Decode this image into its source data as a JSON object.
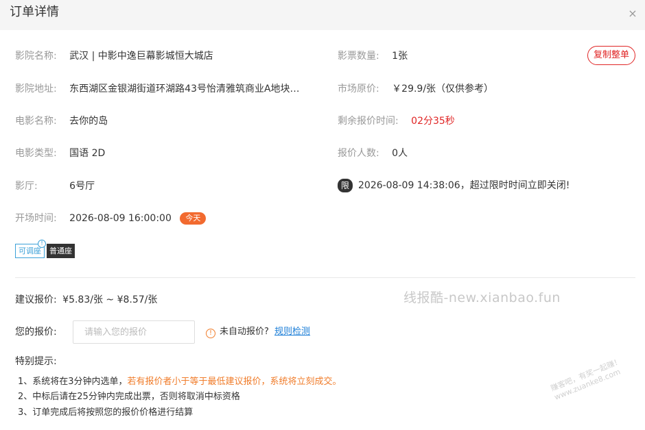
{
  "header": {
    "title": "订单详情",
    "close_glyph": "×"
  },
  "left_fields": [
    {
      "label": "影院名称:",
      "value": "武汉 | 中影中逸巨幕影城恒大城店"
    },
    {
      "label": "影院地址:",
      "value": "东西湖区金银湖街道环湖路43号怡清雅筑商业A地块…"
    },
    {
      "label": "电影名称:",
      "value": "去你的岛"
    },
    {
      "label": "电影类型:",
      "value": "国语 2D"
    },
    {
      "label": "影厅:",
      "value": "6号厅"
    },
    {
      "label": "开场时间:",
      "value": "2026-08-09 16:00:00",
      "badge": "今天"
    }
  ],
  "right_fields": [
    {
      "label": "影票数量:",
      "value": "1张"
    },
    {
      "label": "市场原价:",
      "value": "￥29.9/张（仅供参考）"
    },
    {
      "label": "剩余报价时间:",
      "value": "02分35秒"
    },
    {
      "label": "报价人数:",
      "value": "0人"
    }
  ],
  "deadline": {
    "badge": "限",
    "text": "2026-08-09 14:38:06，超过限时时间立即关闭!"
  },
  "copy_button": "复制整单",
  "seat_tags": {
    "adjustable": "可调座",
    "info_glyph": "!",
    "normal": "普通座"
  },
  "suggested": {
    "label": "建议报价:",
    "value": "¥5.83/张 ~ ¥8.57/张"
  },
  "your_price": {
    "label": "您的报价:",
    "placeholder": "请输入您的报价",
    "warn_glyph": "!",
    "warn_text": "未自动报价?",
    "link": "规则检测"
  },
  "notes": {
    "title": "特别提示:",
    "item1_a": "1、系统将在3分钟内选单，",
    "item1_b": "若有报价者小于等于最低建议报价，系统将立刻成交。",
    "item2": "2、中标后请在25分钟内完成出票，否则将取消中标资格",
    "item3": "3、订单完成后将按照您的报价价格进行结算"
  },
  "watermark": "线报酷-new.xianbao.fun",
  "watermark2": "赚客吧，有奖一起赚！www.zuanke8.com",
  "colors": {
    "accent_red": "#e02424",
    "accent_orange": "#f07c2a",
    "link_blue": "#1a7dd7"
  }
}
